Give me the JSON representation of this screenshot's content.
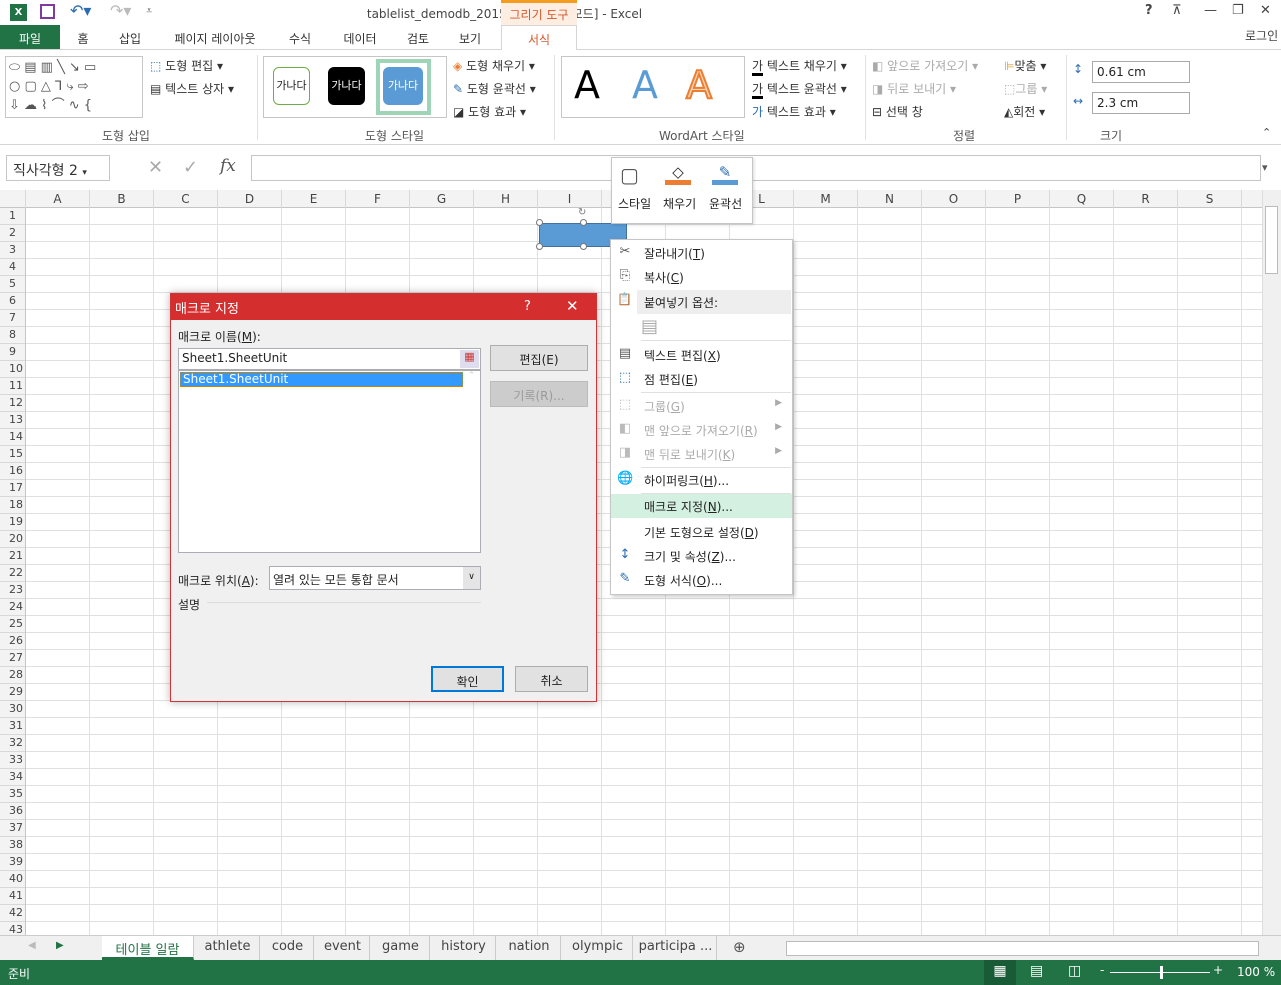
{
  "titlebar": {
    "title": "tablelist_demodb_20151224  [호환 모드] - Excel",
    "contextual_tab": "그리기 도구",
    "help": "?",
    "login": "로그인"
  },
  "tabs": [
    "파일",
    "홈",
    "삽입",
    "페이지 레이아웃",
    "수식",
    "데이터",
    "검토",
    "보기",
    "서식"
  ],
  "ribbon": {
    "insert_shapes": {
      "label": "도형 삽입",
      "edit_shape": "도형 편집",
      "text_box": "텍스트 상자"
    },
    "shape_styles": {
      "label": "도형 스타일",
      "samples": [
        "가나다",
        "가나다",
        "가나다"
      ],
      "fill": "도형 채우기",
      "outline": "도형 윤곽선",
      "effects": "도형 효과"
    },
    "wordart": {
      "label": "WordArt 스타일",
      "samples": [
        "A",
        "A",
        "A"
      ],
      "text_fill": "텍스트 채우기",
      "text_outline": "텍스트 윤곽선",
      "text_effects": "텍스트 효과"
    },
    "arrange": {
      "label": "정렬",
      "bring_forward": "앞으로 가져오기",
      "send_backward": "뒤로 보내기",
      "selection_pane": "선택 창",
      "align": "맞춤",
      "group": "그룹",
      "rotate": "회전"
    },
    "size": {
      "label": "크기",
      "height": "0.61 cm",
      "width": "2.3 cm"
    }
  },
  "formula_bar": {
    "name_box": "직사각형 2",
    "fx": "fx",
    "value": ""
  },
  "columns": [
    "A",
    "B",
    "C",
    "D",
    "E",
    "F",
    "G",
    "H",
    "I",
    "J",
    "K",
    "L",
    "M",
    "N",
    "O",
    "P",
    "Q",
    "R",
    "S"
  ],
  "rows": [
    "1",
    "2",
    "3",
    "4",
    "5",
    "6",
    "7",
    "8",
    "9",
    "10",
    "11",
    "12",
    "13",
    "14",
    "15",
    "16",
    "17",
    "18",
    "19",
    "20",
    "21",
    "22",
    "23",
    "24",
    "25",
    "26",
    "27",
    "28",
    "29",
    "30",
    "31",
    "32",
    "33",
    "34",
    "35",
    "36",
    "37",
    "38",
    "39",
    "40",
    "41",
    "42",
    "43"
  ],
  "sheets": {
    "tabs": [
      "테이블 일람",
      "athlete",
      "code",
      "event",
      "game",
      "history",
      "nation",
      "olympic",
      "participa ..."
    ],
    "active": 0
  },
  "status": {
    "ready": "준비",
    "zoom": "100 %",
    "zoom_percent": 100
  },
  "mini_toolbar": {
    "style": "스타일",
    "fill": "채우기",
    "outline": "윤곽선"
  },
  "context_menu": {
    "cut": {
      "label": "잘라내기",
      "key": "T"
    },
    "copy": {
      "label": "복사",
      "key": "C"
    },
    "paste_options": "붙여넣기 옵션:",
    "edit_text": {
      "label": "텍스트 편집",
      "key": "X"
    },
    "edit_points": {
      "label": "점 편집",
      "key": "E"
    },
    "group": {
      "label": "그룹",
      "key": "G"
    },
    "bring_front": {
      "label": "맨 앞으로 가져오기",
      "key": "R"
    },
    "send_back": {
      "label": "맨 뒤로 보내기",
      "key": "K"
    },
    "hyperlink": {
      "label": "하이퍼링크",
      "key": "H",
      "suffix": "..."
    },
    "assign_macro": {
      "label": "매크로 지정",
      "key": "N",
      "suffix": "..."
    },
    "set_default": {
      "label": "기본 도형으로 설정",
      "key": "D"
    },
    "size_props": {
      "label": "크기 및 속성",
      "key": "Z",
      "suffix": "..."
    },
    "format_shape": {
      "label": "도형 서식",
      "key": "O",
      "suffix": "..."
    }
  },
  "dialog": {
    "title": "매크로 지정",
    "help": "?",
    "name_label": "매크로 이름",
    "name_key": "M",
    "name_value": "Sheet1.SheetUnit",
    "list": [
      "Sheet1.SheetUnit"
    ],
    "edit_button": "편집(E)",
    "record_button": "기록(R)...",
    "location_label": "매크로 위치",
    "location_key": "A",
    "location_value": "열려 있는 모든 통합 문서",
    "description_label": "설명",
    "ok": "확인",
    "cancel": "취소"
  },
  "colors": {
    "excel_green": "#217346",
    "accent_orange": "#d2572a",
    "dialog_red": "#d42e2e",
    "shape_blue": "#5b9bd5",
    "selection": "#3399ff",
    "menu_hover": "#d3f0e0"
  }
}
